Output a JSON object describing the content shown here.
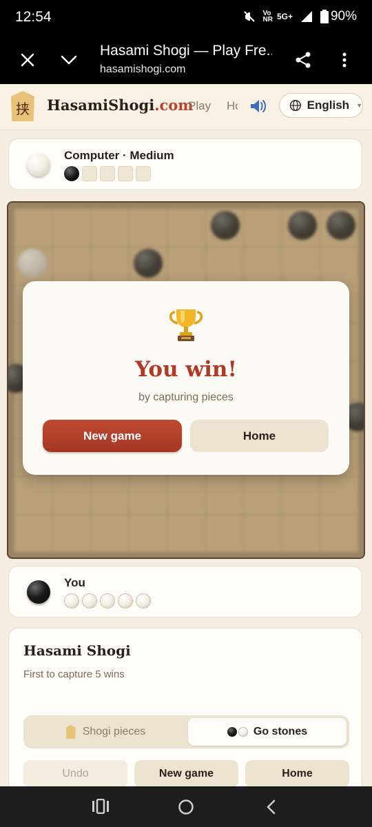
{
  "status_bar": {
    "time": "12:54",
    "net_top": "Vo",
    "net_bottom": "NR",
    "net_type": "5G+",
    "battery": "90%"
  },
  "browser": {
    "title": "Hasami Shogi — Play Fre...",
    "url": "hasamishogi.com"
  },
  "site_header": {
    "logo_char": "挟",
    "brand_main": "HasamiShogi",
    "brand_suffix": ".com",
    "nav_play": "Play",
    "nav_how": "How",
    "language": "English"
  },
  "opponent": {
    "name": "Computer · Medium",
    "stone_color": "white",
    "captured": 1,
    "capture_slots": 5
  },
  "player": {
    "name": "You",
    "stone_color": "black",
    "captured": 5,
    "capture_slots": 5
  },
  "win_modal": {
    "icon": "trophy-icon",
    "title": "You win!",
    "subtitle": "by capturing pieces",
    "primary_button": "New game",
    "secondary_button": "Home"
  },
  "info_panel": {
    "title": "Hasami Shogi",
    "subtitle": "First to capture 5 wins",
    "piece_style_options": [
      "Shogi pieces",
      "Go stones"
    ],
    "piece_style_selected": "Go stones",
    "actions": [
      "Undo",
      "New game",
      "Home"
    ]
  },
  "colors": {
    "accent": "#b8412b",
    "page_bg": "#f5ede0",
    "card_bg": "#fffdf7",
    "secondary_button": "#ece4d1"
  }
}
